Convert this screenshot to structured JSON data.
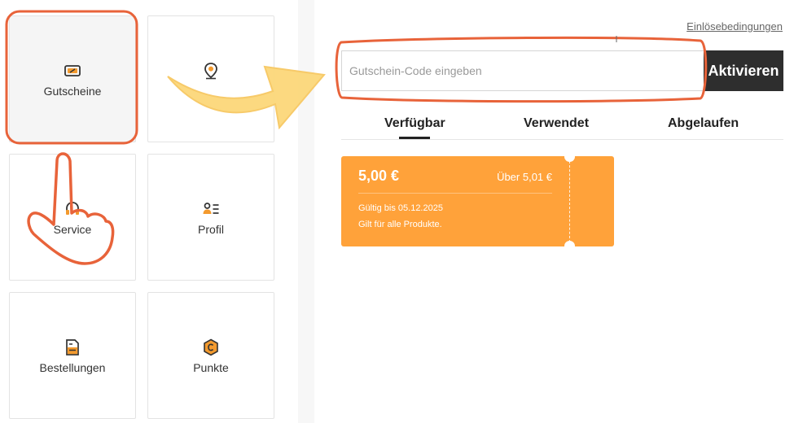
{
  "menu": {
    "tiles": [
      {
        "label": "Gutscheine",
        "icon": "voucher-icon"
      },
      {
        "label": "",
        "icon": "location-pin-icon"
      },
      {
        "label": "Service",
        "icon": "headset-icon"
      },
      {
        "label": "Profil",
        "icon": "profile-list-icon"
      },
      {
        "label": "Bestellungen",
        "icon": "order-document-icon"
      },
      {
        "label": "Punkte",
        "icon": "coin-icon"
      }
    ]
  },
  "voucher": {
    "terms_link": "Einlösebedingungen",
    "code_placeholder": "Gutschein-Code eingeben",
    "activate_label": "Aktivieren",
    "tabs": [
      {
        "label": "Verfügbar",
        "selected": true
      },
      {
        "label": "Verwendet",
        "selected": false
      },
      {
        "label": "Abgelaufen",
        "selected": false
      }
    ],
    "coupons": [
      {
        "amount": "5,00 €",
        "minimum": "Über 5,01 €",
        "valid_until": "Gültig bis 05.12.2025",
        "scope": "Gilt für alle Produkte."
      }
    ]
  },
  "colors": {
    "accent_orange": "#ffa23a",
    "button_dark": "#2e2e2e",
    "annotation_outline": "#e8633a",
    "annotation_arrow": "#fcd87a"
  },
  "annotations": {
    "highlight_shape": "red rounded outlines",
    "arrow": "yellow-arrow",
    "pointer": "hand-pointer-icon"
  }
}
